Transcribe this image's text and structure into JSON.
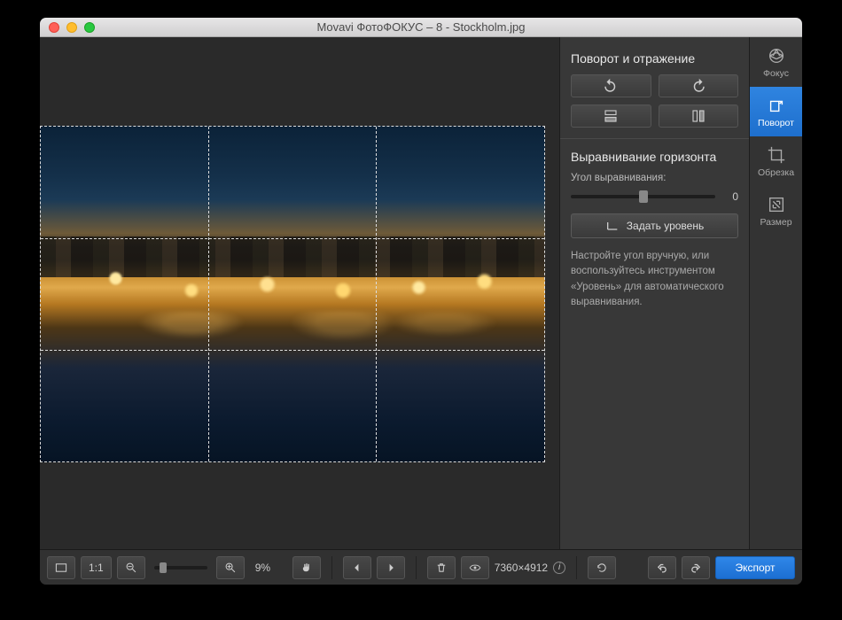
{
  "window": {
    "title": "Movavi ФотоФОКУС – 8 - Stockholm.jpg"
  },
  "panel": {
    "rotate_title": "Поворот и отражение",
    "horizon_title": "Выравнивание горизонта",
    "angle_label": "Угол выравнивания:",
    "angle_value": "0",
    "level_button": "Задать уровень",
    "hint": "Настройте угол вручную, или воспользуйтесь инструментом «Уровень» для автоматического выравнивания."
  },
  "tools": {
    "focus": "Фокус",
    "rotate": "Поворот",
    "crop": "Обрезка",
    "resize": "Размер"
  },
  "bottombar": {
    "fit_label": "1:1",
    "zoom_pct": "9%",
    "dimensions": "7360×4912",
    "export": "Экспорт"
  }
}
